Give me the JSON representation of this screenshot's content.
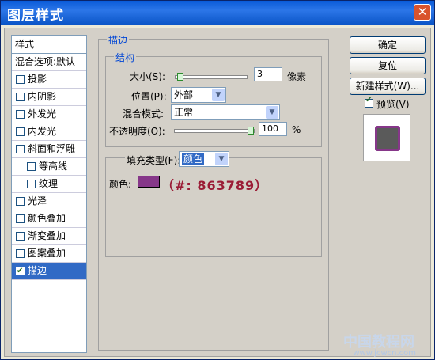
{
  "window": {
    "title": "图层样式",
    "close_glyph": "✕"
  },
  "style_list": {
    "header": "样式",
    "blend_default": "混合选项:默认",
    "items": [
      {
        "label": "投影",
        "checked": false,
        "indent": false,
        "selected": false
      },
      {
        "label": "内阴影",
        "checked": false,
        "indent": false,
        "selected": false
      },
      {
        "label": "外发光",
        "checked": false,
        "indent": false,
        "selected": false
      },
      {
        "label": "内发光",
        "checked": false,
        "indent": false,
        "selected": false
      },
      {
        "label": "斜面和浮雕",
        "checked": false,
        "indent": false,
        "selected": false
      },
      {
        "label": "等高线",
        "checked": false,
        "indent": true,
        "selected": false
      },
      {
        "label": "纹理",
        "checked": false,
        "indent": true,
        "selected": false
      },
      {
        "label": "光泽",
        "checked": false,
        "indent": false,
        "selected": false
      },
      {
        "label": "颜色叠加",
        "checked": false,
        "indent": false,
        "selected": false
      },
      {
        "label": "渐变叠加",
        "checked": false,
        "indent": false,
        "selected": false
      },
      {
        "label": "图案叠加",
        "checked": false,
        "indent": false,
        "selected": false
      },
      {
        "label": "描边",
        "checked": true,
        "indent": false,
        "selected": true
      }
    ]
  },
  "stroke": {
    "title": "描边",
    "structure": {
      "title": "结构",
      "size_label": "大小(S):",
      "size_value": "3",
      "size_unit": "像素",
      "size_slider": 0.02,
      "position_label": "位置(P):",
      "position_value": "外部",
      "blend_label": "混合模式:",
      "blend_value": "正常",
      "opacity_label": "不透明度(O):",
      "opacity_value": "100",
      "opacity_unit": "%",
      "opacity_slider": 1.0
    },
    "fill": {
      "type_label": "填充类型(F):",
      "type_value": "颜色",
      "color_label": "颜色:",
      "color_hex": "#863789",
      "color_annotation": "（#: 863789）"
    }
  },
  "buttons": {
    "ok": "确定",
    "reset": "复位",
    "new_style": "新建样式(W)...",
    "preview_label": "预览(V)",
    "preview_checked": true
  },
  "preview": {
    "fill_color": "#5a5a5a",
    "stroke_color": "#863789"
  },
  "watermark": {
    "text": "中国教程网",
    "url": "www.jcwcn.com"
  },
  "icons": {
    "dropdown": "▼",
    "check": "✔"
  }
}
